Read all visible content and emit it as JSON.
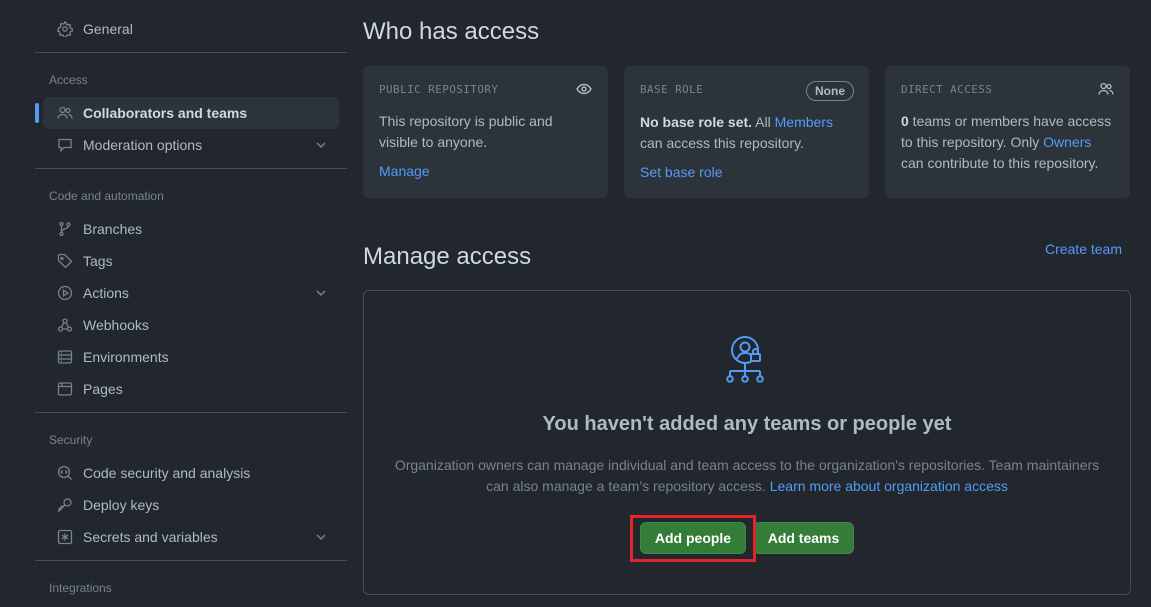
{
  "sidebar": {
    "general": "General",
    "sections": {
      "access": "Access",
      "code": "Code and automation",
      "security": "Security",
      "integrations": "Integrations"
    },
    "items": {
      "collaborators": "Collaborators and teams",
      "moderation": "Moderation options",
      "branches": "Branches",
      "tags": "Tags",
      "actions": "Actions",
      "webhooks": "Webhooks",
      "environments": "Environments",
      "pages": "Pages",
      "code_security": "Code security and analysis",
      "deploy_keys": "Deploy keys",
      "secrets": "Secrets and variables"
    }
  },
  "who_has_access": {
    "title": "Who has access",
    "public_repo": {
      "heading": "PUBLIC REPOSITORY",
      "text": "This repository is public and visible to anyone.",
      "link": "Manage"
    },
    "base_role": {
      "heading": "BASE ROLE",
      "badge": "None",
      "bold": "No base role set.",
      "text_pre": " All ",
      "members_link": "Members",
      "text_post": " can access this repository.",
      "link": "Set base role"
    },
    "direct_access": {
      "heading": "DIRECT ACCESS",
      "count": "0",
      "text_pre": " teams or members have access to this repository. Only ",
      "owners_link": "Owners",
      "text_post": " can contribute to this repository."
    }
  },
  "manage_access": {
    "title": "Manage access",
    "create_team": "Create team",
    "empty_title": "You haven't added any teams or people yet",
    "empty_desc": "Organization owners can manage individual and team access to the organization's repositories. Team maintainers can also manage a team's repository access.",
    "learn_more": "Learn more about organization access",
    "add_people": "Add people",
    "add_teams": "Add teams"
  },
  "colors": {
    "background": "#22272e",
    "card": "#2d333b",
    "link": "#539bf5",
    "primary_button": "#347d39",
    "highlight": "#e3242b"
  },
  "icons": [
    "gear-icon",
    "people-icon",
    "comment-icon",
    "branch-icon",
    "tag-icon",
    "play-icon",
    "webhook-icon",
    "server-icon",
    "browser-icon",
    "codescan-icon",
    "key-icon",
    "asterisk-icon",
    "eye-icon",
    "chevron-down-icon",
    "person-lock-icon"
  ]
}
